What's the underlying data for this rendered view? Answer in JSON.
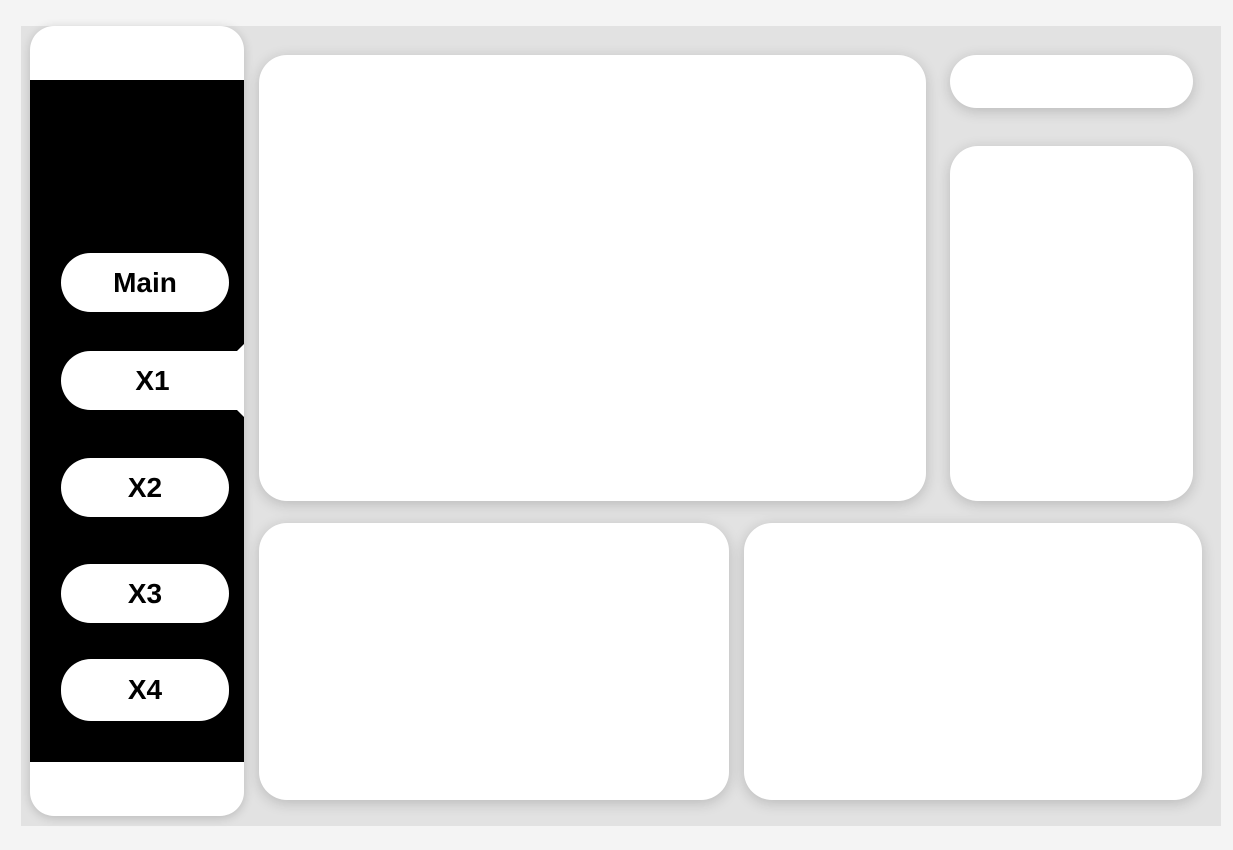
{
  "sidebar": {
    "items": [
      {
        "label": "Main",
        "active": false
      },
      {
        "label": "X1",
        "active": true
      },
      {
        "label": "X2",
        "active": false
      },
      {
        "label": "X3",
        "active": false
      },
      {
        "label": "X4",
        "active": false
      }
    ]
  },
  "colors": {
    "nav_background": "#000000",
    "card_background": "#ffffff",
    "page_background": "#e2e2e2"
  }
}
